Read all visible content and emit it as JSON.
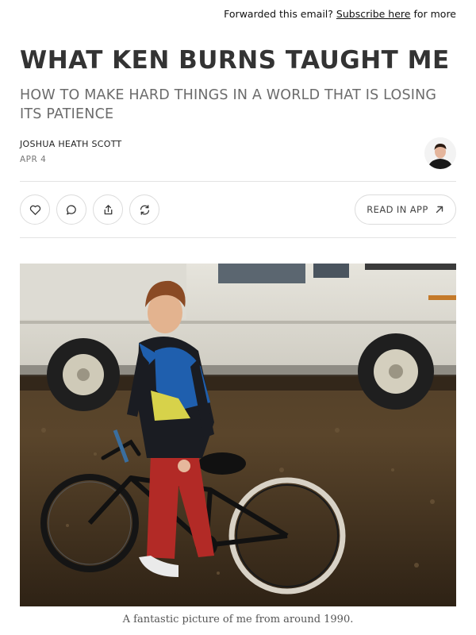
{
  "forward_bar": {
    "prefix": "Forwarded this email?",
    "link": "Subscribe here",
    "suffix": "for more"
  },
  "post": {
    "title": "WHAT KEN BURNS TAUGHT ME",
    "subtitle": "HOW TO MAKE HARD THINGS IN A WORLD THAT IS LOSING ITS PATIENCE",
    "author": "JOSHUA HEATH SCOTT",
    "date": "APR 4"
  },
  "actions": {
    "like_icon": "heart-icon",
    "comment_icon": "comment-icon",
    "share_icon": "share-icon",
    "restack_icon": "restack-icon",
    "read_in_app": "READ IN APP",
    "read_in_app_icon": "arrow-up-right-icon"
  },
  "image": {
    "caption": "A fantastic picture of me from around 1990."
  }
}
